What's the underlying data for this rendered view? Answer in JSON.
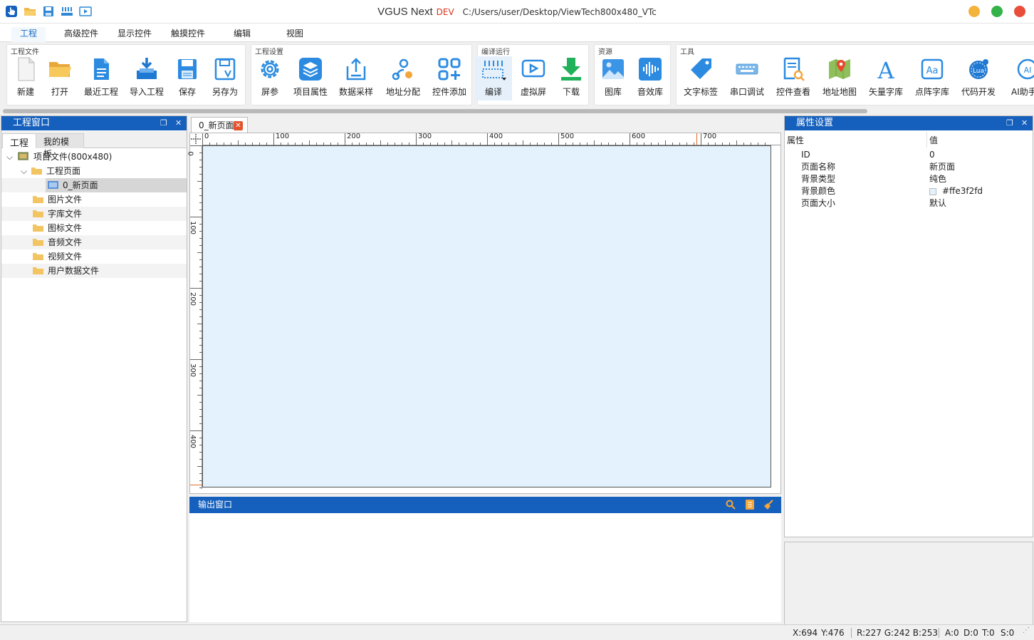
{
  "window": {
    "app_name": "VGUS Next",
    "edition": "DEV",
    "path": "C:/Users/user/Desktop/ViewTech800x480_VTc"
  },
  "colors": {
    "accent": "#1560bd",
    "brand_blue": "#1f8fe6",
    "dev_red": "#d9341b",
    "page_bg": "#e3f2fd",
    "close_dot": "#f4b33b",
    "max_dot": "#34b34a",
    "min_dot": "#e94e3a"
  },
  "quick_access": [
    "app-logo-icon",
    "open-folder-icon",
    "save-icon",
    "compile-icon",
    "preview-icon"
  ],
  "ribbon_tabs": [
    "工程",
    "高级控件",
    "显示控件",
    "触摸控件",
    "编辑",
    "视图"
  ],
  "ribbon_groups": [
    {
      "label": "工程文件",
      "buttons": [
        "新建",
        "打开",
        "最近工程",
        "导入工程",
        "保存",
        "另存为"
      ]
    },
    {
      "label": "工程设置",
      "buttons": [
        "屏参",
        "项目属性",
        "数据采样",
        "地址分配",
        "控件添加"
      ]
    },
    {
      "label": "编译运行",
      "buttons": [
        "编译",
        "虚拟屏",
        "下载"
      ]
    },
    {
      "label": "资源",
      "buttons": [
        "图库",
        "音效库"
      ]
    },
    {
      "label": "工具",
      "buttons": [
        "文字标签",
        "串口调试",
        "控件查看",
        "地址地图",
        "矢量字库",
        "点阵字库",
        "代码开发",
        "AI助手"
      ]
    }
  ],
  "left_panel": {
    "title": "工程窗口",
    "tabs": [
      "工程",
      "我的模板"
    ],
    "tree": {
      "root": "项目文件(800x480)",
      "pages_folder": "工程页面",
      "page": "0_新页面",
      "folders": [
        "图片文件",
        "字库文件",
        "图标文件",
        "音频文件",
        "视频文件",
        "用户数据文件"
      ]
    }
  },
  "document": {
    "tab": "0_新页面",
    "h_ruler": [
      "0",
      "100",
      "200",
      "300",
      "400",
      "500",
      "600",
      "700"
    ],
    "v_ruler": [
      "0",
      "100",
      "200",
      "300",
      "400"
    ]
  },
  "output": {
    "title": "输出窗口"
  },
  "properties": {
    "title": "属性设置",
    "col_name": "属性",
    "col_value": "值",
    "rows": [
      {
        "name": "ID",
        "value": "0"
      },
      {
        "name": "页面名称",
        "value": "新页面"
      },
      {
        "name": "背景类型",
        "value": "纯色"
      },
      {
        "name": "背景颜色",
        "value": "#ffe3f2fd"
      },
      {
        "name": "页面大小",
        "value": "默认"
      }
    ]
  },
  "status": {
    "x": "X:694",
    "y": "Y:476",
    "rgb": "R:227 G:242 B:253",
    "a": "A:0",
    "d": "D:0",
    "t": "T:0",
    "s": "S:0"
  }
}
